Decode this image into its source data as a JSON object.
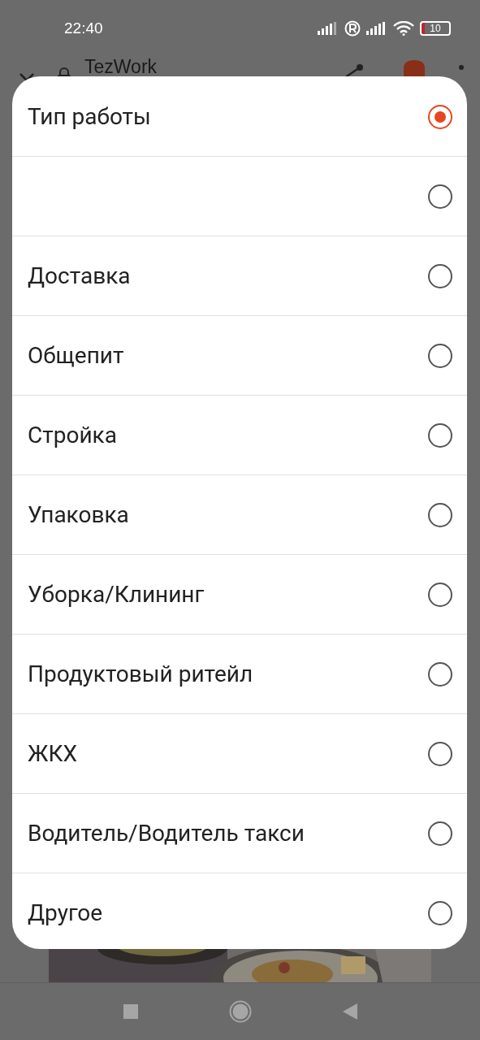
{
  "status_bar": {
    "time": "22:40",
    "battery": "10"
  },
  "app_bar": {
    "title": "TezWork"
  },
  "dialog": {
    "options": [
      {
        "label": "Тип работы",
        "selected": true
      },
      {
        "selected": false
      },
      {
        "label": "Доставка",
        "selected": false
      },
      {
        "label": "Общепит",
        "selected": false
      },
      {
        "label": "Стройка",
        "selected": false
      },
      {
        "label": "Упаковка",
        "selected": false
      },
      {
        "label": "Уборка/Клининг",
        "selected": false
      },
      {
        "label": "Продуктовый ритейл",
        "selected": false
      },
      {
        "label": "ЖКХ",
        "selected": false
      },
      {
        "label": "Водитель/Водитель такси",
        "selected": false
      },
      {
        "label": "Другое",
        "selected": false
      }
    ]
  }
}
